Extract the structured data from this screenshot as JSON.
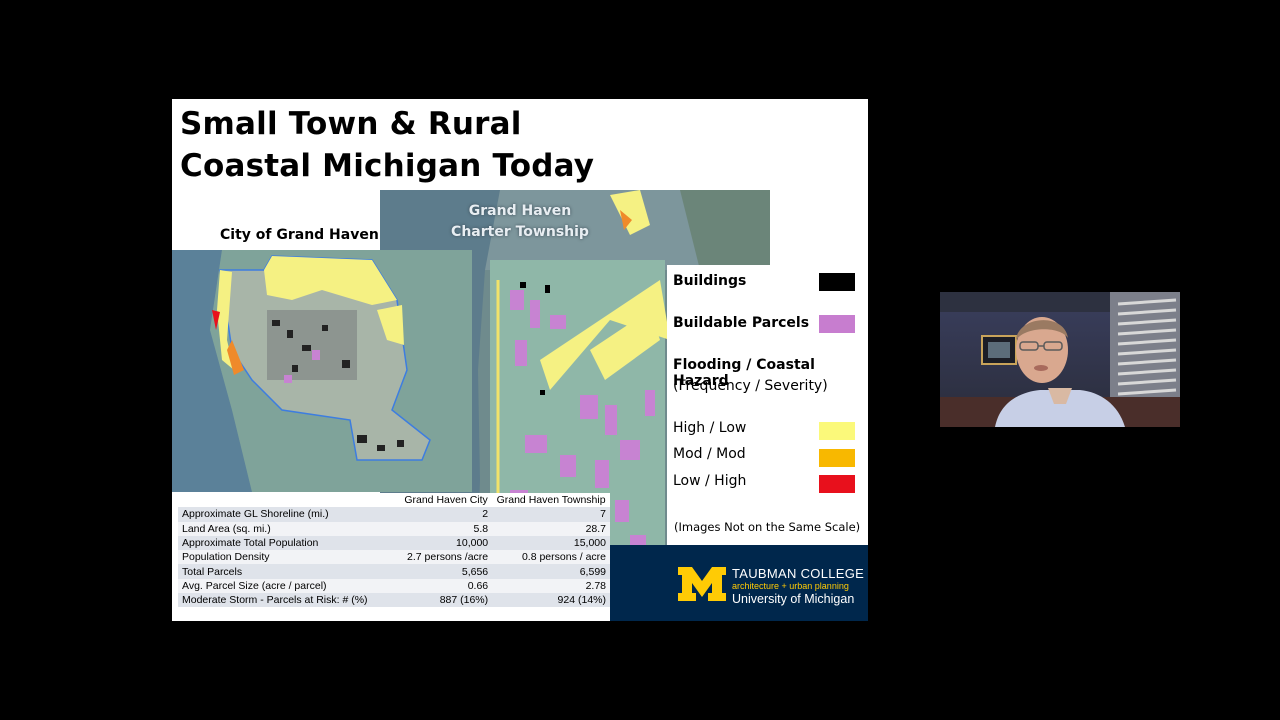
{
  "slide": {
    "title_line1": "Small Town & Rural",
    "title_line2": "Coastal Michigan Today",
    "map_city_label": "City of Grand Haven",
    "map_township_label_line1": "Grand Haven",
    "map_township_label_line2": "Charter Township",
    "legend": {
      "buildings": "Buildings",
      "buildable_parcels": "Buildable Parcels",
      "flooding_title": "Flooding / Coastal Hazard",
      "flooding_subtitle": "(Frequency / Severity)",
      "high_low": "High / Low",
      "mod_mod": "Mod / Mod",
      "low_high": "Low / High",
      "colors": {
        "buildings": "#000000",
        "buildable_parcels": "#c77dcf",
        "high_low": "#fbf97a",
        "mod_mod": "#f8b800",
        "low_high": "#e8101c"
      }
    },
    "note": "(Images Not on the Same Scale)",
    "table": {
      "headers": [
        "",
        "Grand Haven City",
        "Grand Haven Township"
      ],
      "rows": [
        [
          "Approximate GL Shoreline (mi.)",
          "2",
          "7"
        ],
        [
          "Land Area (sq. mi.)",
          "5.8",
          "28.7"
        ],
        [
          "Approximate Total Population",
          "10,000",
          "15,000"
        ],
        [
          "Population Density",
          "2.7 persons /acre",
          "0.8 persons / acre"
        ],
        [
          "Total Parcels",
          "5,656",
          "6,599"
        ],
        [
          "Avg. Parcel Size (acre / parcel)",
          "0.66",
          "2.78"
        ],
        [
          "Moderate Storm - Parcels at Risk: # (%)",
          "887 (16%)",
          "924 (14%)"
        ]
      ]
    },
    "footer": {
      "line1": "TAUBMAN COLLEGE",
      "line2": "architecture + urban planning",
      "line3": "University of Michigan",
      "bg_color": "#00274c",
      "maize_color": "#ffcb05"
    }
  },
  "webcam": {
    "icon": "presenter-video-feed"
  }
}
